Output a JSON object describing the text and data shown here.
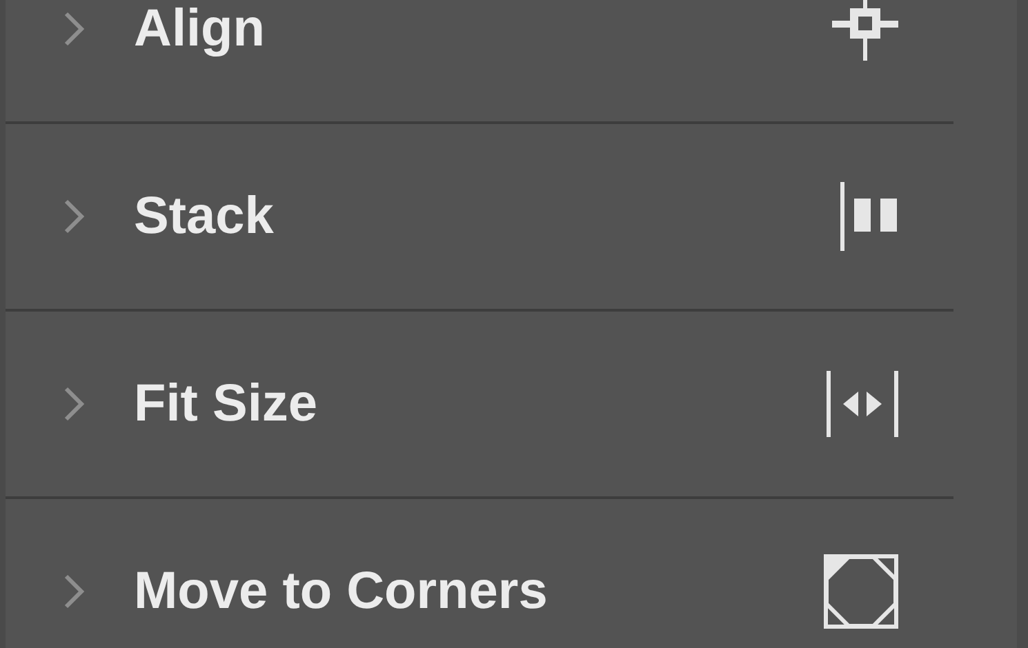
{
  "sections": [
    {
      "label": "Align",
      "expanded": false,
      "kind": "align"
    },
    {
      "label": "Stack",
      "expanded": false,
      "kind": "stack"
    },
    {
      "label": "Fit Size",
      "expanded": false,
      "kind": "fit"
    },
    {
      "label": "Move to Corners",
      "expanded": false,
      "kind": "corners"
    }
  ]
}
